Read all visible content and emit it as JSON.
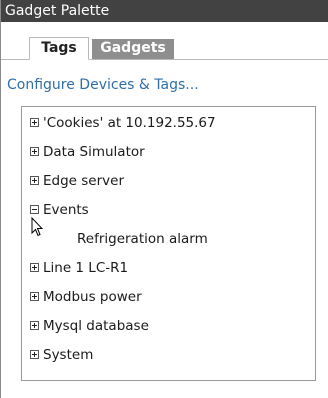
{
  "window": {
    "title": "Gadget Palette"
  },
  "tabs": [
    {
      "label": "Tags",
      "active": true
    },
    {
      "label": "Gadgets",
      "active": false
    }
  ],
  "configure_link": "Configure Devices & Tags...",
  "tree": {
    "items": [
      {
        "label": "'Cookies' at 10.192.55.67",
        "expanded": false
      },
      {
        "label": "Data Simulator",
        "expanded": false
      },
      {
        "label": "Edge server",
        "expanded": false
      },
      {
        "label": "Events",
        "expanded": true,
        "children": [
          "Refrigeration alarm"
        ]
      },
      {
        "label": "Line 1 LC-R1",
        "expanded": false
      },
      {
        "label": "Modbus power",
        "expanded": false
      },
      {
        "label": "Mysql database",
        "expanded": false
      },
      {
        "label": "System",
        "expanded": false
      }
    ]
  },
  "colors": {
    "titlebar": "#424242",
    "link": "#2f6ea8",
    "inactive_tab": "#8e8e8e"
  }
}
